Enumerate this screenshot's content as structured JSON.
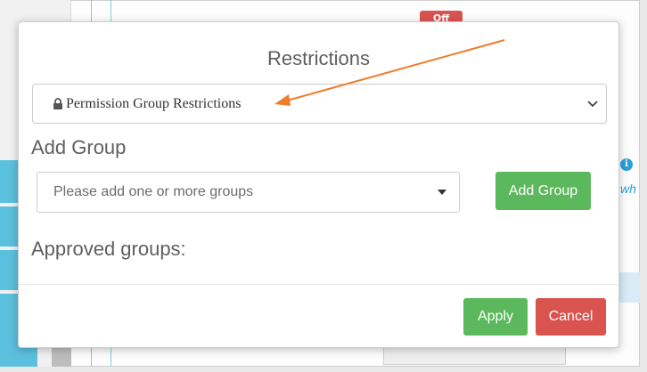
{
  "background": {
    "badge_text": "Off",
    "info_glyph": "i",
    "partial_text": "wh"
  },
  "modal": {
    "title": "Restrictions",
    "permission_select": {
      "icon": "lock-icon",
      "value": "Permission Group Restrictions"
    },
    "add_group_heading": "Add Group",
    "group_select": {
      "placeholder": "Please add one or more groups"
    },
    "add_group_button": "Add Group",
    "approved_groups_heading": "Approved groups:",
    "footer": {
      "apply_label": "Apply",
      "cancel_label": "Cancel"
    }
  },
  "colors": {
    "success": "#5cb85c",
    "danger": "#d9534f",
    "info": "#5bc0de",
    "annotation_arrow": "#f07c2a"
  }
}
